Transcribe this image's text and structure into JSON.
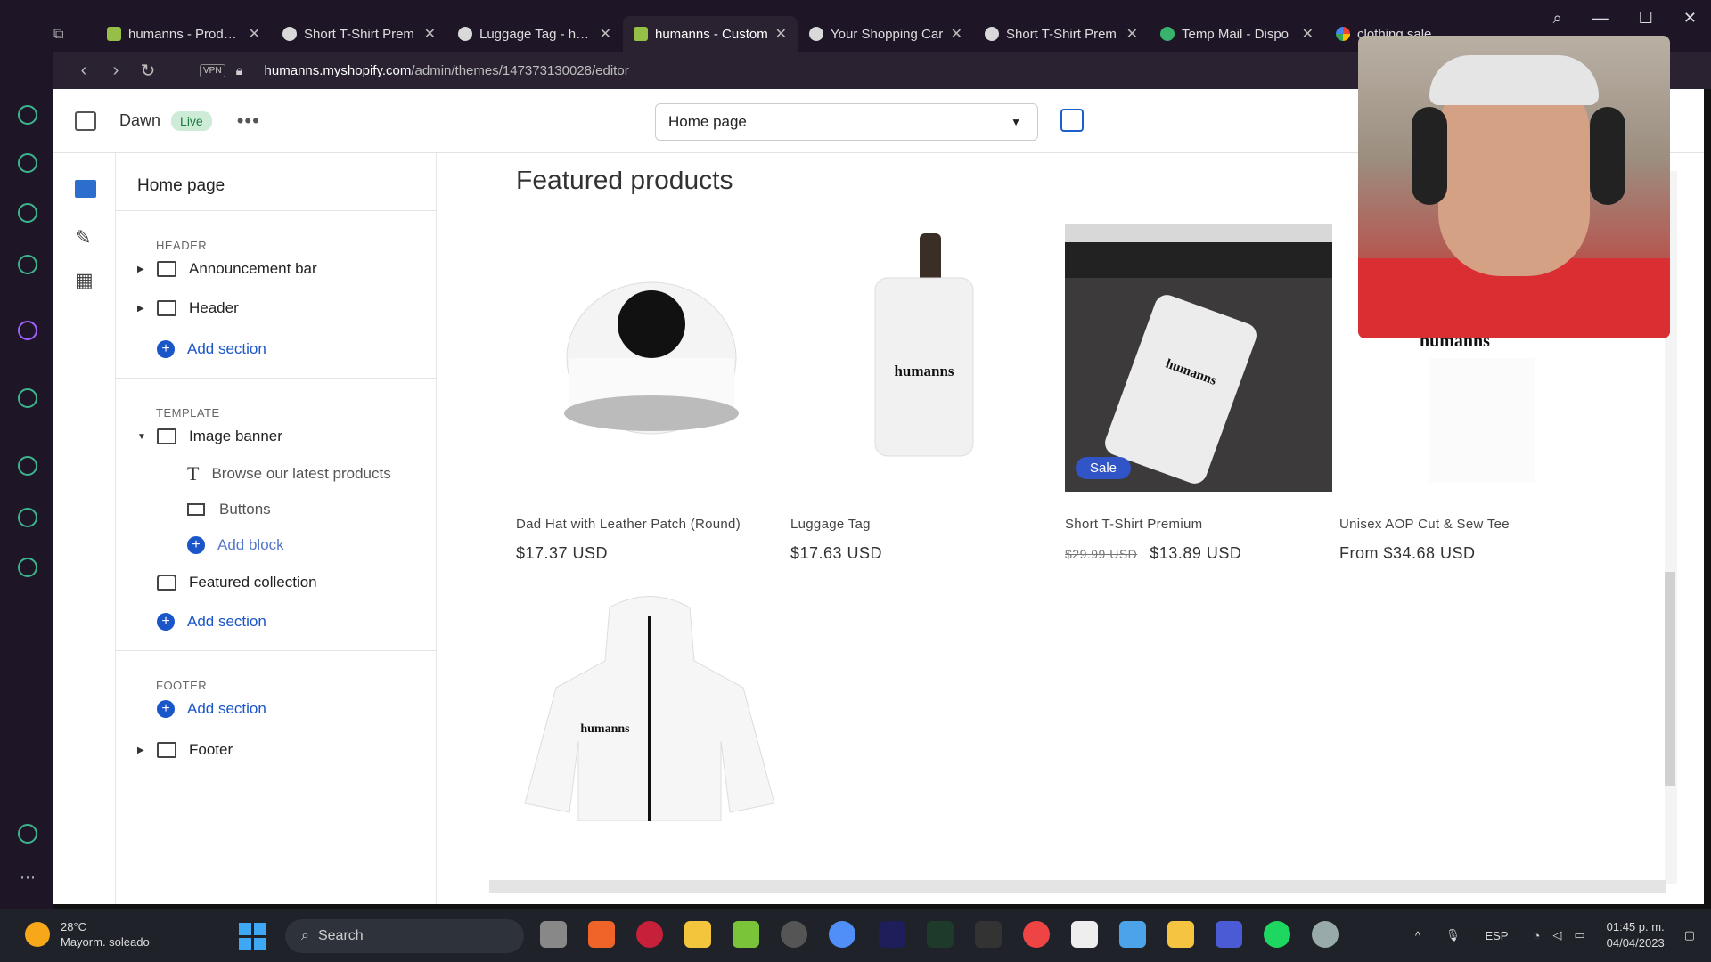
{
  "browser": {
    "tabs": [
      {
        "label": "humanns - Producti",
        "icon": "shopify-icon"
      },
      {
        "label": "Short T-Shirt Prem",
        "icon": "globe-icon"
      },
      {
        "label": "Luggage Tag - hum",
        "icon": "globe-icon"
      },
      {
        "label": "humanns - Custom",
        "icon": "shopify-icon",
        "active": true
      },
      {
        "label": "Your Shopping Car",
        "icon": "globe-icon"
      },
      {
        "label": "Short T-Shirt Prem",
        "icon": "globe-icon"
      },
      {
        "label": "Temp Mail - Dispo",
        "icon": "mail-icon"
      },
      {
        "label": "clothing sales sum",
        "icon": "google-icon"
      }
    ],
    "url_host": "humanns.myshopify.com",
    "url_path": "/admin/themes/147373130028/editor",
    "accent": "#2a2231"
  },
  "editor": {
    "theme_name": "Dawn",
    "live_badge": "Live",
    "more": "•••",
    "page_select": "Home page",
    "sidebar": {
      "title": "Home page",
      "header_group": "HEADER",
      "template_group": "TEMPLATE",
      "footer_group": "FOOTER",
      "announcement_bar": "Announcement bar",
      "header": "Header",
      "add_section": "Add section",
      "image_banner": "Image banner",
      "browse": "Browse our latest products",
      "buttons": "Buttons",
      "add_block": "Add block",
      "featured_collection": "Featured collection",
      "footer": "Footer"
    }
  },
  "preview": {
    "title": "Featured products",
    "products": [
      {
        "name": "Dad Hat with Leather Patch (Round)",
        "price": "$17.37 USD"
      },
      {
        "name": "Luggage Tag",
        "price": "$17.63 USD"
      },
      {
        "name": "Short T-Shirt Premium",
        "old_price": "$29.99 USD",
        "price": "$13.89 USD",
        "badge": "Sale"
      },
      {
        "name": "Unisex AOP Cut & Sew Tee",
        "price": "From $34.68 USD"
      }
    ],
    "brand": "humanns"
  },
  "taskbar": {
    "temp": "28°C",
    "weather": "Mayorm. soleado",
    "search": "Search",
    "lang": "ESP",
    "time": "01:45 p. m.",
    "date": "04/04/2023"
  }
}
